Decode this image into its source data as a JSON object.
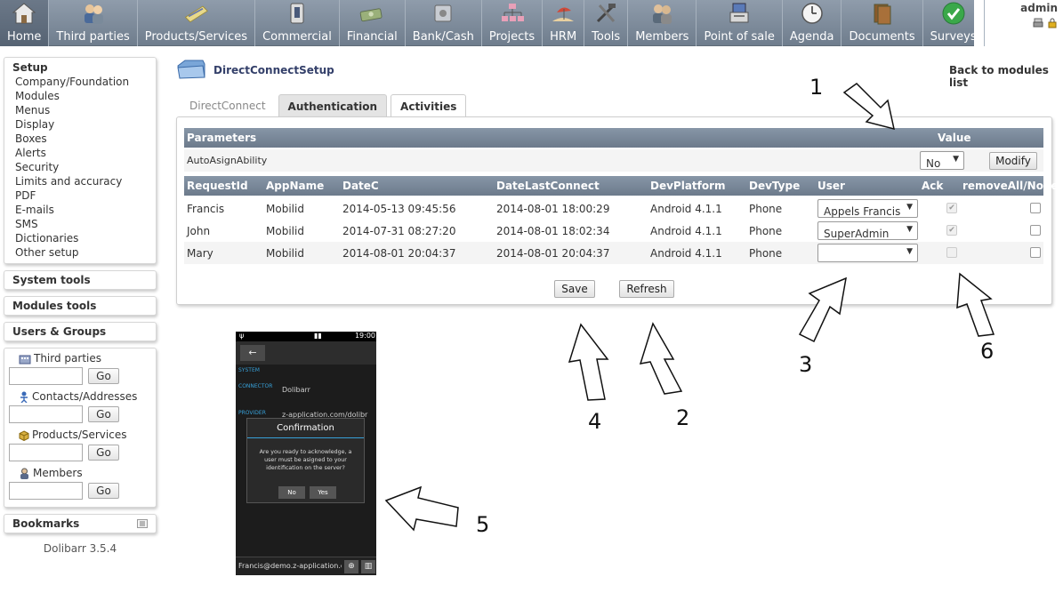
{
  "topmenu": {
    "items": [
      {
        "label": "Home",
        "icon": "home-icon"
      },
      {
        "label": "Third parties",
        "icon": "third-parties-icon"
      },
      {
        "label": "Products/Services",
        "icon": "products-icon"
      },
      {
        "label": "Commercial",
        "icon": "commercial-icon"
      },
      {
        "label": "Financial",
        "icon": "financial-icon"
      },
      {
        "label": "Bank/Cash",
        "icon": "bank-icon"
      },
      {
        "label": "Projects",
        "icon": "projects-icon"
      },
      {
        "label": "HRM",
        "icon": "hrm-icon"
      },
      {
        "label": "Tools",
        "icon": "tools-icon"
      },
      {
        "label": "Members",
        "icon": "members-icon"
      },
      {
        "label": "Point of sale",
        "icon": "pos-icon"
      },
      {
        "label": "Agenda",
        "icon": "agenda-icon"
      },
      {
        "label": "Documents",
        "icon": "documents-icon"
      },
      {
        "label": "Surveys",
        "icon": "surveys-icon"
      }
    ],
    "user": "admin"
  },
  "leftmenu": {
    "setup_title": "Setup",
    "setup_items": [
      "Company/Foundation",
      "Modules",
      "Menus",
      "Display",
      "Boxes",
      "Alerts",
      "Security",
      "Limits and accuracy",
      "PDF",
      "E-mails",
      "SMS",
      "Dictionaries",
      "Other setup"
    ],
    "system_tools": "System tools",
    "modules_tools": "Modules tools",
    "users_groups": "Users & Groups",
    "quick_search": [
      {
        "label": "Third parties",
        "go": "Go"
      },
      {
        "label": "Contacts/Addresses",
        "go": "Go"
      },
      {
        "label": "Products/Services",
        "go": "Go"
      },
      {
        "label": "Members",
        "go": "Go"
      }
    ],
    "bookmarks": "Bookmarks",
    "version": "Dolibarr 3.5.4"
  },
  "page": {
    "title": "DirectConnectSetup",
    "back_link": "Back to modules list",
    "tabs": [
      "DirectConnect",
      "Authentication",
      "Activities"
    ],
    "params_header": {
      "name": "Parameters",
      "value": "Value"
    },
    "param": {
      "name": "AutoAsignAbility",
      "value": "No",
      "modify": "Modify"
    },
    "table_headers": {
      "request_id": "RequestId",
      "app_name": "AppName",
      "date_c": "DateC",
      "date_last": "DateLastConnect",
      "platform": "DevPlatform",
      "type": "DevType",
      "user": "User",
      "ack": "Ack",
      "remove": "removeAll/None"
    },
    "rows": [
      {
        "request_id": "Francis",
        "app_name": "Mobilid",
        "date_c": "2014-05-13 09:45:56",
        "date_last": "2014-08-01 18:00:29",
        "platform": "Android 4.1.1",
        "type": "Phone",
        "user": "Appels Francis",
        "ack": "✔"
      },
      {
        "request_id": "John",
        "app_name": "Mobilid",
        "date_c": "2014-07-31 08:27:20",
        "date_last": "2014-08-01 18:02:34",
        "platform": "Android 4.1.1",
        "type": "Phone",
        "user": "SuperAdmin",
        "ack": "✔"
      },
      {
        "request_id": "Mary",
        "app_name": "Mobilid",
        "date_c": "2014-08-01 20:04:37",
        "date_last": "2014-08-01 20:04:37",
        "platform": "Android 4.1.1",
        "type": "Phone",
        "user": "",
        "ack": ""
      }
    ],
    "save": "Save",
    "refresh": "Refresh"
  },
  "phone": {
    "time": "19:00",
    "section_system": "SYSTEM",
    "section_connector": "CONNECTOR",
    "connector_value": "Dolibarr",
    "section_provider": "PROVIDER",
    "provider_value": "z-application.com/dolibr",
    "dialog_title": "Confirmation",
    "dialog_message": "Are you ready to acknowledge, a user must be asigned to your identification on the server?",
    "no": "No",
    "yes": "Yes",
    "email": "Francis@demo.z-application.c"
  },
  "annotations": [
    "1",
    "2",
    "3",
    "4",
    "5",
    "6"
  ]
}
